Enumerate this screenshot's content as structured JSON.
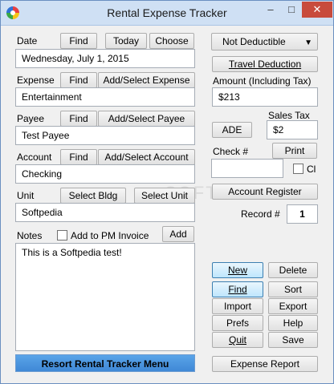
{
  "window": {
    "title": "Rental Expense Tracker",
    "minimize": "–",
    "maximize": "□",
    "close": "✕"
  },
  "date": {
    "label": "Date",
    "find": "Find",
    "today": "Today",
    "choose": "Choose",
    "value": "Wednesday, July 1, 2015"
  },
  "expense": {
    "label": "Expense",
    "find": "Find",
    "add_select": "Add/Select Expense",
    "value": "Entertainment"
  },
  "payee": {
    "label": "Payee",
    "find": "Find",
    "add_select": "Add/Select Payee",
    "value": "Test Payee"
  },
  "account": {
    "label": "Account",
    "find": "Find",
    "add_select": "Add/Select Account",
    "value": "Checking"
  },
  "unit": {
    "label": "Unit",
    "select_bldg": "Select Bldg",
    "select_unit": "Select Unit",
    "value": "Softpedia"
  },
  "notes": {
    "label": "Notes",
    "add_to_pm": "Add to PM Invoice",
    "add": "Add",
    "value": "This is a Softpedia test!"
  },
  "right": {
    "deductible_selected": "Not Deductible",
    "travel_deduction": "Travel Deduction",
    "amount_label": "Amount (Including Tax)",
    "amount_value": "$213",
    "sales_tax_label": "Sales Tax",
    "ade": "ADE",
    "sales_tax_value": "$2",
    "check_label": "Check #",
    "print": "Print",
    "check_value": "",
    "cl_label": "Cl",
    "account_register": "Account Register",
    "record_label": "Record #",
    "record_value": "1"
  },
  "actions": {
    "new": "New",
    "delete": "Delete",
    "find": "Find",
    "sort": "Sort",
    "import": "Import",
    "export": "Export",
    "prefs": "Prefs",
    "help": "Help",
    "quit": "Quit",
    "save": "Save",
    "expense_report": "Expense Report",
    "resort_menu": "Resort Rental Tracker Menu"
  },
  "watermark": "SOFTP"
}
